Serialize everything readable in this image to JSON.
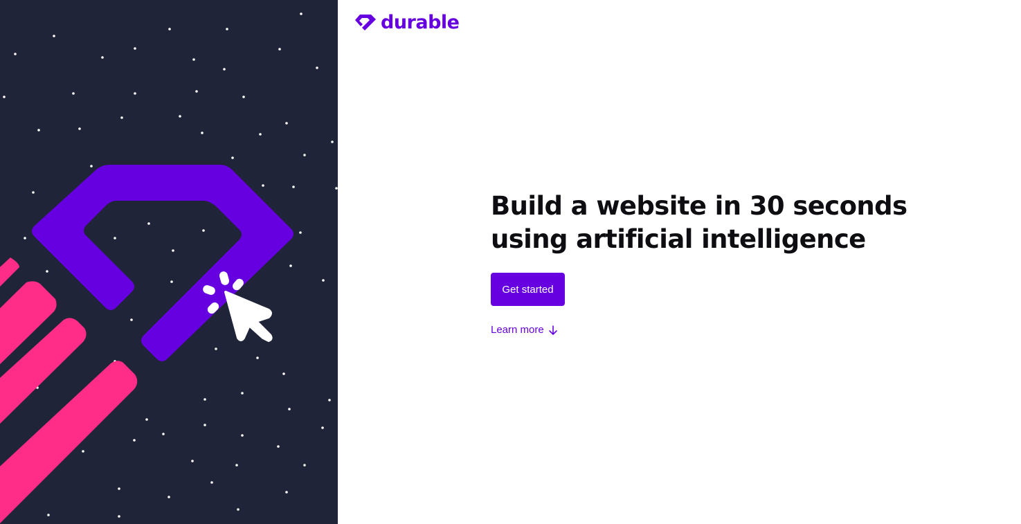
{
  "brand": {
    "name": "durable",
    "color": "#6600e0",
    "logo_icon": "diamond-logo-icon"
  },
  "hero": {
    "headline_line1": "Build a website in 30 seconds",
    "headline_line2": "using artificial intelligence",
    "cta_label": "Get started",
    "learn_more_label": "Learn more",
    "learn_more_icon": "arrow-down-icon"
  },
  "illustration": {
    "background_color": "#1f2438",
    "diamond_color": "#6600e0",
    "stripe_color": "#ff2d87",
    "cursor_icon": "cursor-click-icon"
  }
}
